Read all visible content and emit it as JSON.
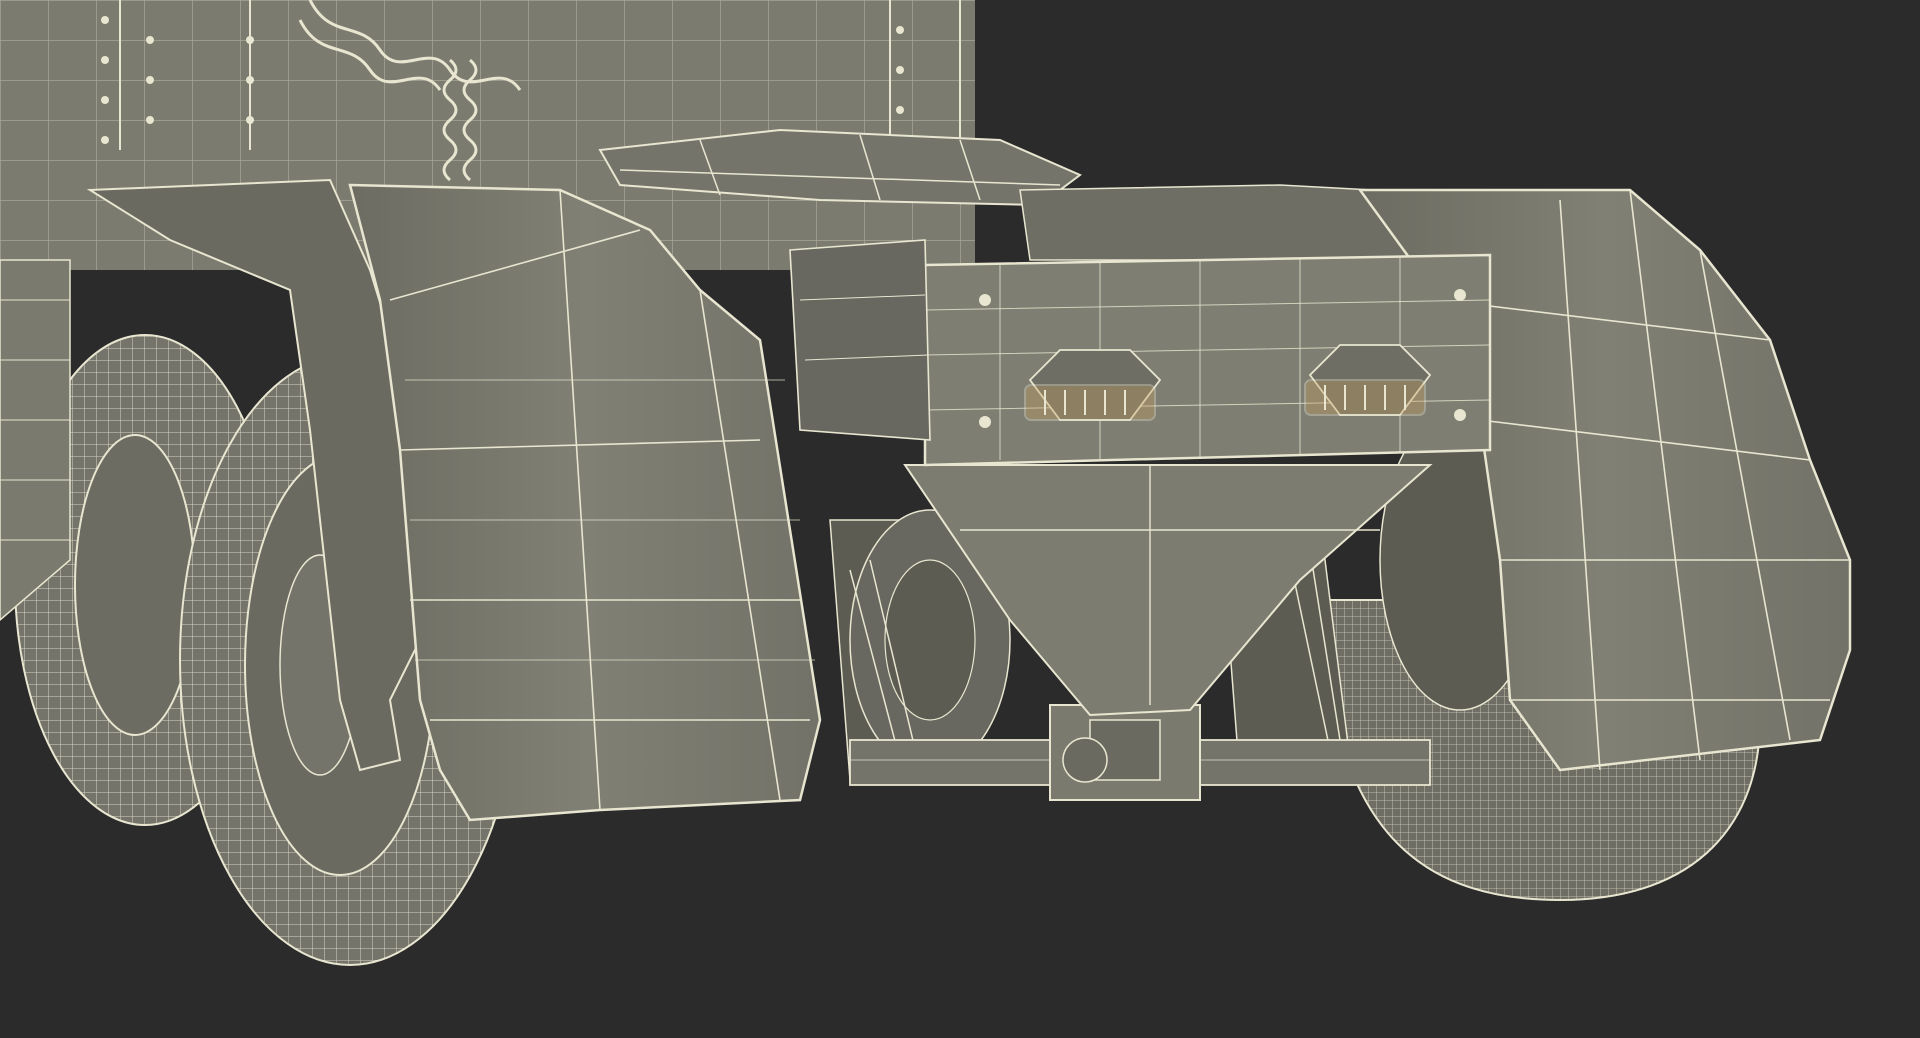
{
  "scene": {
    "subject": "truck-tractor-rear-wireframe",
    "background_color": "#2b2b2b",
    "surface_color": "#7a7a6e",
    "surface_shadow_color": "#5c5c52",
    "wire_color": "#e8e6d0",
    "amber_lens_color": "#c8a060"
  }
}
